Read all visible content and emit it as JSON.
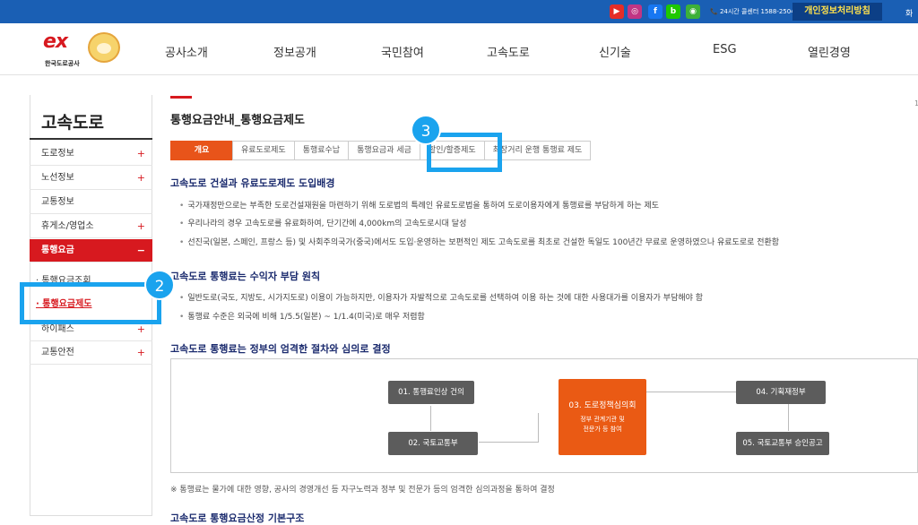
{
  "topbar": {
    "sns": [
      {
        "icon": "youtube-icon",
        "glyph": "▶",
        "color": "#e52d27"
      },
      {
        "icon": "instagram-icon",
        "glyph": "◎",
        "color": "#c13584"
      },
      {
        "icon": "facebook-icon",
        "glyph": "f",
        "color": "#1877f2"
      },
      {
        "icon": "blog-icon",
        "glyph": "b",
        "color": "#1ec800"
      },
      {
        "icon": "kakao-icon",
        "glyph": "◉",
        "color": "#3db039"
      }
    ],
    "callcenter": "📞 24시간 콜센터 1588-2504",
    "privacy": "개인정보처리방침",
    "more": "화"
  },
  "header": {
    "logo_ex": "ex",
    "logo_name": "한국도로공사",
    "gnb": [
      "공사소개",
      "정보공개",
      "국민참여",
      "고속도로",
      "신기술",
      "ESG",
      "열린경영"
    ]
  },
  "sidebar": {
    "title": "고속도로",
    "items": [
      {
        "label": "도로정보",
        "pm": "+"
      },
      {
        "label": "노선정보",
        "pm": "+"
      },
      {
        "label": "교통정보",
        "pm": ""
      },
      {
        "label": "휴게소/영업소",
        "pm": "+"
      },
      {
        "label": "통행요금",
        "pm": "−"
      },
      {
        "label": "하이패스",
        "pm": "+"
      },
      {
        "label": "교통안전",
        "pm": "+"
      }
    ],
    "subitems": [
      "· 통행요금조회",
      "· 통행요금제도"
    ]
  },
  "main": {
    "title": "통행요금안내_통행요금제도",
    "tabs": [
      "개요",
      "유료도로제도",
      "통행료수납",
      "통행요금과 세금",
      "할인/할증제도",
      "최장거리 운행 통행료 제도"
    ],
    "sections": [
      {
        "heading": "고속도로 건설과 유료도로제도 도입배경",
        "bullets": [
          "국가재정만으로는 부족한 도로건설재원을 마련하기 위해 도로법의 특례인 유료도로법을 통하여 도로이용자에게 통행료를 부담하게 하는 제도",
          "우리나라의 경우 고속도로를 유료화하여, 단기간에 4,000km의 고속도로시대 달성",
          "선진국(일본, 스페인, 프랑스 등) 및 사회주의국가(중국)에서도 도입·운영하는 보편적인 제도 고속도로를 최초로 건설한 독일도 100년간 무료로 운영하였으나 유료도로로 전환함"
        ]
      },
      {
        "heading": "고속도로 통행료는 수익자 부담 원칙",
        "bullets": [
          "일반도로(국도, 지방도, 시가지도로) 이용이 가능하지만, 이용자가 자발적으로 고속도로를 선택하여 이용 하는 것에 대한 사용대가를 이용자가 부담해야 함",
          "통행료 수준은 외국에 비해 1/5.5(일본) ~ 1/1.4(미국)로 매우 저렴함"
        ]
      },
      {
        "heading": "고속도로 통행료는 정부의 엄격한 절차와 심의로 결정",
        "bullets": []
      }
    ],
    "flow": {
      "step1": "01. 통행료인상 건의",
      "step2": "02. 국토교통부",
      "step3_title": "03. 도로정책심의회",
      "step3_sub1": "정부 관계기관 및",
      "step3_sub2": "전문가 등 참여",
      "step4": "04. 기획재정부",
      "step5": "05. 국토교통부 승인공고"
    },
    "footnote": "※ 통행료는 물가에 대한 영향, 공사의 경영개선 등 자구노력과 정부 및 전문가 등의 엄격한 심의과정을 통하여 결정",
    "cut_heading": "고속도로 통행요금산정 기본구조"
  },
  "annotations": {
    "badge2": "2",
    "badge3": "3",
    "color": "#1aa3ee"
  },
  "scroll_hint": "1"
}
